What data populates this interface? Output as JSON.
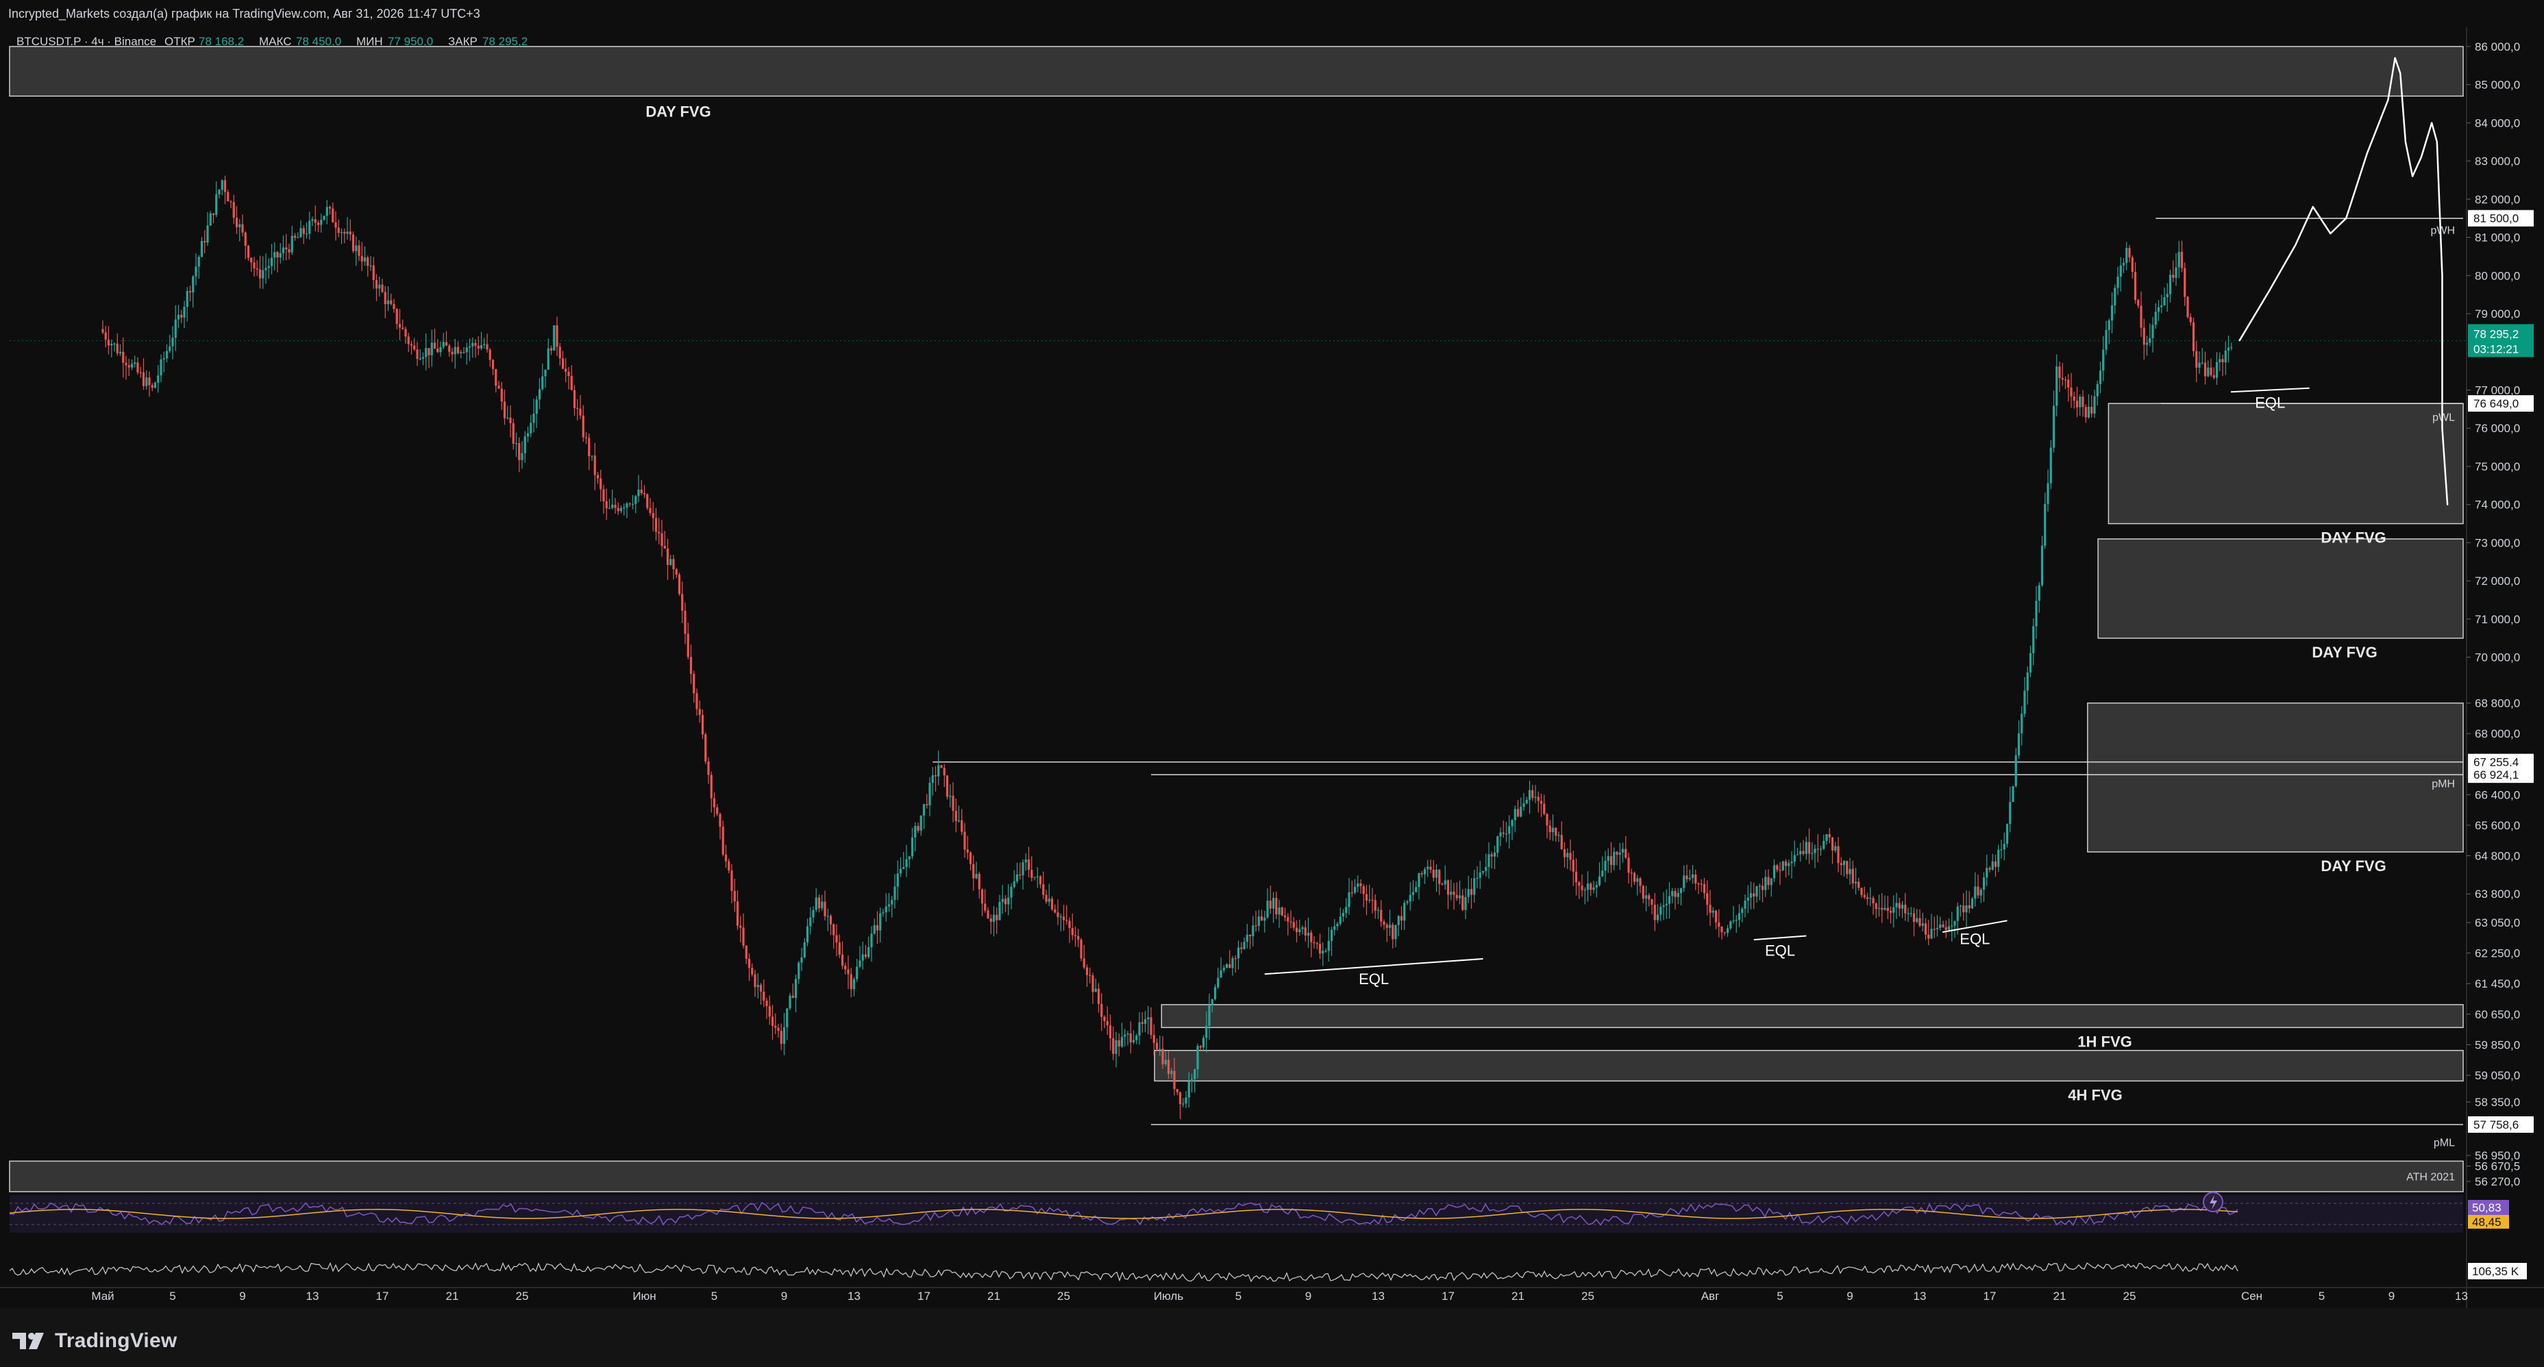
{
  "header": {
    "author_line": "Incrypted_Markets создал(а) график на TradingView.com, Авг 31, 2026 11:47 UTC+3"
  },
  "legend": {
    "symbol": "BTCUSDT.P · 4ч · Binance",
    "open_label": "ОТКР",
    "open_value": "78 168,2",
    "high_label": "МАКС",
    "high_value": "78 450,0",
    "low_label": "МИН",
    "low_value": "77 950,0",
    "close_label": "ЗАКР",
    "close_value": "78 295,2"
  },
  "colors": {
    "background": "#0e0e0e",
    "bull": "#26a69a",
    "bear": "#ef5350",
    "zone_fill": "#3a3a3a",
    "zone_stroke": "#cfcfcf",
    "price_badge": "#089981",
    "rsi": "#7e57c2",
    "rsi_ma": "#f0b429",
    "text": "#d1d4dc"
  },
  "price_axis": {
    "ticks": [
      "86 000,0",
      "85 000,0",
      "84 000,0",
      "83 000,0",
      "82 000,0",
      "81 000,0",
      "80 000,0",
      "79 000,0",
      "77 000,0",
      "76 000,0",
      "75 000,0",
      "74 000,0",
      "73 000,0",
      "72 000,0",
      "71 000,0",
      "70 000,0",
      "68 800,0",
      "68 000,0",
      "66 400,0",
      "65 600,0",
      "64 800,0",
      "63 800,0",
      "63 050,0",
      "62 250,0",
      "61 450,0",
      "60 650,0",
      "59 850,0",
      "59 050,0",
      "58 350,0",
      "56 950,0",
      "56 670,5",
      "56 270,0"
    ],
    "badges": [
      {
        "text": "81 500,0",
        "price": 81500
      },
      {
        "text": "76 649,0",
        "price": 76649
      },
      {
        "text": "67 255,4",
        "price": 67255.4
      },
      {
        "text": "66 924,1",
        "price": 66924.1
      },
      {
        "text": "57 758,6",
        "price": 57758.6
      }
    ],
    "current_price": "78 295,2",
    "countdown": "03:12:21",
    "rsi_value_1": "50,83",
    "rsi_value_2": "48,45",
    "volume_value": "106,35 K"
  },
  "time_axis": {
    "labels": [
      "Май",
      "5",
      "9",
      "13",
      "17",
      "21",
      "25",
      "Июн",
      "5",
      "9",
      "13",
      "17",
      "21",
      "25",
      "Июль",
      "5",
      "9",
      "13",
      "17",
      "21",
      "25",
      "Авг",
      "5",
      "9",
      "13",
      "17",
      "21",
      "25",
      "Сен",
      "5",
      "9",
      "13"
    ]
  },
  "annotations": {
    "day_fvg_top": "DAY FVG",
    "day_fvg_1": "DAY FVG",
    "day_fvg_2": "DAY FVG",
    "day_fvg_3": "DAY FVG",
    "fvg_1h": "1H FVG",
    "fvg_4h": "4H FVG",
    "eql_1": "EQL",
    "eql_2": "EQL",
    "eql_3": "EQL",
    "eql_4": "EQL",
    "pwh": "pWH",
    "pwl": "pWL",
    "pmh": "pMH",
    "pml": "pML",
    "ath": "ATH 2021"
  },
  "chart_data": {
    "type": "candlestick",
    "symbol": "BTCUSDT.P",
    "timeframe": "4ч",
    "exchange": "Binance",
    "ylim": [
      56000,
      86500
    ],
    "x_range": [
      "May 1",
      "Sep 15"
    ],
    "path_points": [
      {
        "day": 0,
        "price": 78600
      },
      {
        "day": 3,
        "price": 77000
      },
      {
        "day": 5,
        "price": 79500
      },
      {
        "day": 7,
        "price": 82500
      },
      {
        "day": 9,
        "price": 80000
      },
      {
        "day": 13,
        "price": 81700
      },
      {
        "day": 15,
        "price": 80500
      },
      {
        "day": 18,
        "price": 78000
      },
      {
        "day": 22,
        "price": 78200
      },
      {
        "day": 24,
        "price": 75200
      },
      {
        "day": 26,
        "price": 78500
      },
      {
        "day": 29,
        "price": 73800
      },
      {
        "day": 31,
        "price": 74300
      },
      {
        "day": 33,
        "price": 72000
      },
      {
        "day": 35,
        "price": 66500
      },
      {
        "day": 37,
        "price": 62000
      },
      {
        "day": 39,
        "price": 60000
      },
      {
        "day": 41,
        "price": 63800
      },
      {
        "day": 43,
        "price": 61500
      },
      {
        "day": 46,
        "price": 64500
      },
      {
        "day": 48,
        "price": 67200
      },
      {
        "day": 51,
        "price": 63000
      },
      {
        "day": 53,
        "price": 64600
      },
      {
        "day": 56,
        "price": 62500
      },
      {
        "day": 58,
        "price": 59800
      },
      {
        "day": 60,
        "price": 60400
      },
      {
        "day": 62,
        "price": 58300
      },
      {
        "day": 64,
        "price": 61500
      },
      {
        "day": 67,
        "price": 63600
      },
      {
        "day": 70,
        "price": 62300
      },
      {
        "day": 72,
        "price": 64100
      },
      {
        "day": 74,
        "price": 62800
      },
      {
        "day": 76,
        "price": 64600
      },
      {
        "day": 78,
        "price": 63500
      },
      {
        "day": 80,
        "price": 65200
      },
      {
        "day": 82,
        "price": 66500
      },
      {
        "day": 85,
        "price": 63800
      },
      {
        "day": 87,
        "price": 65000
      },
      {
        "day": 89,
        "price": 63200
      },
      {
        "day": 91,
        "price": 64400
      },
      {
        "day": 93,
        "price": 62800
      },
      {
        "day": 95,
        "price": 64000
      },
      {
        "day": 97,
        "price": 64900
      },
      {
        "day": 99,
        "price": 65200
      },
      {
        "day": 101,
        "price": 63600
      },
      {
        "day": 103,
        "price": 63400
      },
      {
        "day": 105,
        "price": 62700
      },
      {
        "day": 107,
        "price": 63600
      },
      {
        "day": 109,
        "price": 65000
      },
      {
        "day": 110,
        "price": 68500
      },
      {
        "day": 111,
        "price": 72000
      },
      {
        "day": 112,
        "price": 77500
      },
      {
        "day": 113,
        "price": 76800
      },
      {
        "day": 114,
        "price": 76300
      },
      {
        "day": 115,
        "price": 79000
      },
      {
        "day": 116,
        "price": 80800
      },
      {
        "day": 117,
        "price": 78200
      },
      {
        "day": 118,
        "price": 79200
      },
      {
        "day": 119,
        "price": 80600
      },
      {
        "day": 120,
        "price": 77600
      },
      {
        "day": 121,
        "price": 77400
      },
      {
        "day": 122,
        "price": 78300
      }
    ],
    "zones": [
      {
        "label": "DAY FVG",
        "top": 86000,
        "bottom": 84700
      },
      {
        "label": "DAY FVG",
        "top": 76649,
        "bottom": 73500
      },
      {
        "label": "DAY FVG",
        "top": 73100,
        "bottom": 70500
      },
      {
        "label": "DAY FVG",
        "top": 68800,
        "bottom": 64900
      },
      {
        "label": "1H FVG",
        "top": 60900,
        "bottom": 60300
      },
      {
        "label": "4H FVG",
        "top": 59700,
        "bottom": 58900
      },
      {
        "label": "ATH 2021",
        "top": 56800,
        "bottom": 56000
      }
    ],
    "levels": [
      {
        "label": "pWH",
        "price": 81500
      },
      {
        "label": "pWL",
        "price": 76649
      },
      {
        "label": "pMH",
        "price": 66924.1
      },
      {
        "label": "pML",
        "price": 57758.6
      },
      {
        "label": "",
        "price": 67255.4
      }
    ],
    "rsi": {
      "values": [
        50.83,
        48.45
      ]
    },
    "volume": {
      "last": "106,35 K"
    }
  }
}
